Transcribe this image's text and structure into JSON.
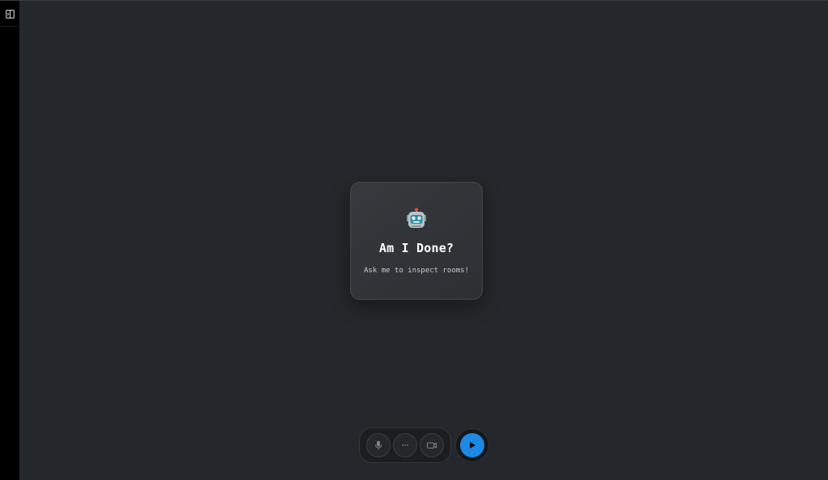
{
  "sidebar": {
    "toggle_icon": "sidebar-toggle-icon"
  },
  "welcome": {
    "icon": "robot-icon",
    "title": "Am I Done?",
    "subtitle": "Ask me to inspect rooms!"
  },
  "controls": {
    "buttons": [
      {
        "name": "microphone",
        "icon": "microphone-icon"
      },
      {
        "name": "more-options",
        "icon": "more-horizontal-icon"
      },
      {
        "name": "camera",
        "icon": "video-camera-icon"
      }
    ],
    "send": {
      "icon": "play-icon",
      "color": "#1e88e5"
    }
  },
  "colors": {
    "background": "#24272b",
    "sidebar": "#000000",
    "accent": "#1e88e5"
  }
}
